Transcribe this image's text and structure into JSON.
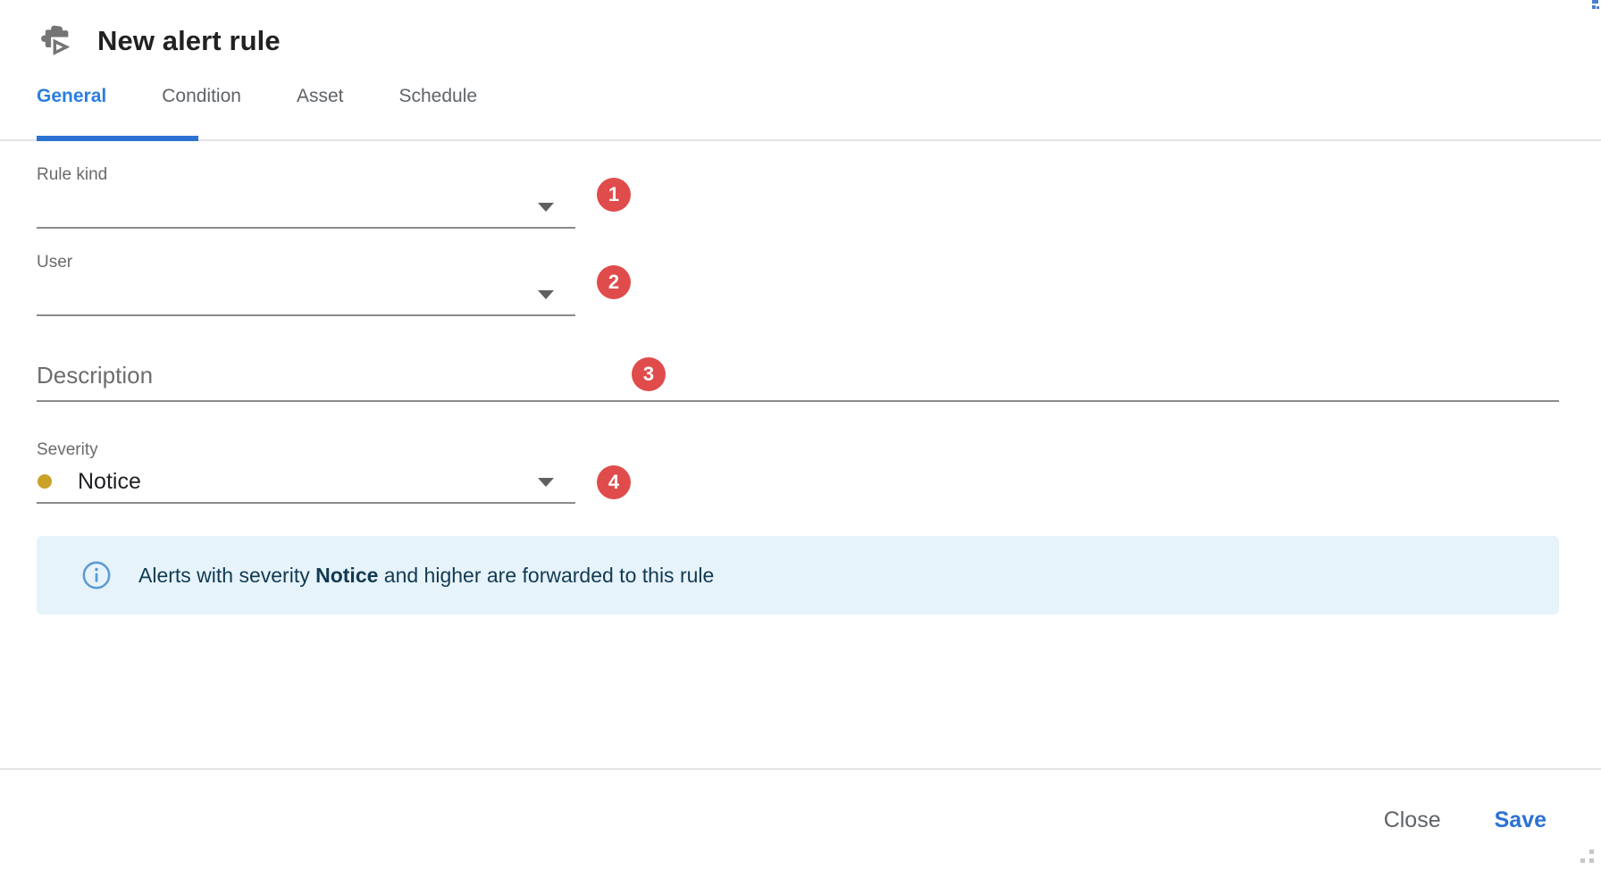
{
  "window": {
    "title": "New alert rule",
    "title_icon": "puzzle-play-icon",
    "accent_color": "#2b72d3",
    "badge_color": "#e04c4c"
  },
  "tabs": [
    {
      "label": "General",
      "active": true
    },
    {
      "label": "Condition",
      "active": false
    },
    {
      "label": "Asset",
      "active": false
    },
    {
      "label": "Schedule",
      "active": false
    }
  ],
  "form": {
    "rule_kind": {
      "label": "Rule kind",
      "value": "",
      "badge": "1",
      "caret_icon": "chevron-down-icon"
    },
    "user": {
      "label": "User",
      "value": "",
      "badge": "2",
      "caret_icon": "chevron-down-icon"
    },
    "description": {
      "placeholder": "Description",
      "value": "",
      "badge": "3"
    },
    "severity": {
      "label": "Severity",
      "value": "Notice",
      "badge": "4",
      "dot_color": "#c9a227",
      "caret_icon": "chevron-down-icon"
    }
  },
  "info_banner": {
    "icon": "info-circle-icon",
    "text_before": "Alerts with severity ",
    "text_bold": "Notice",
    "text_after": " and higher are forwarded to this rule",
    "background_color": "#e6f3fb",
    "text_color": "#123a52"
  },
  "footer": {
    "close_label": "Close",
    "save_label": "Save"
  }
}
